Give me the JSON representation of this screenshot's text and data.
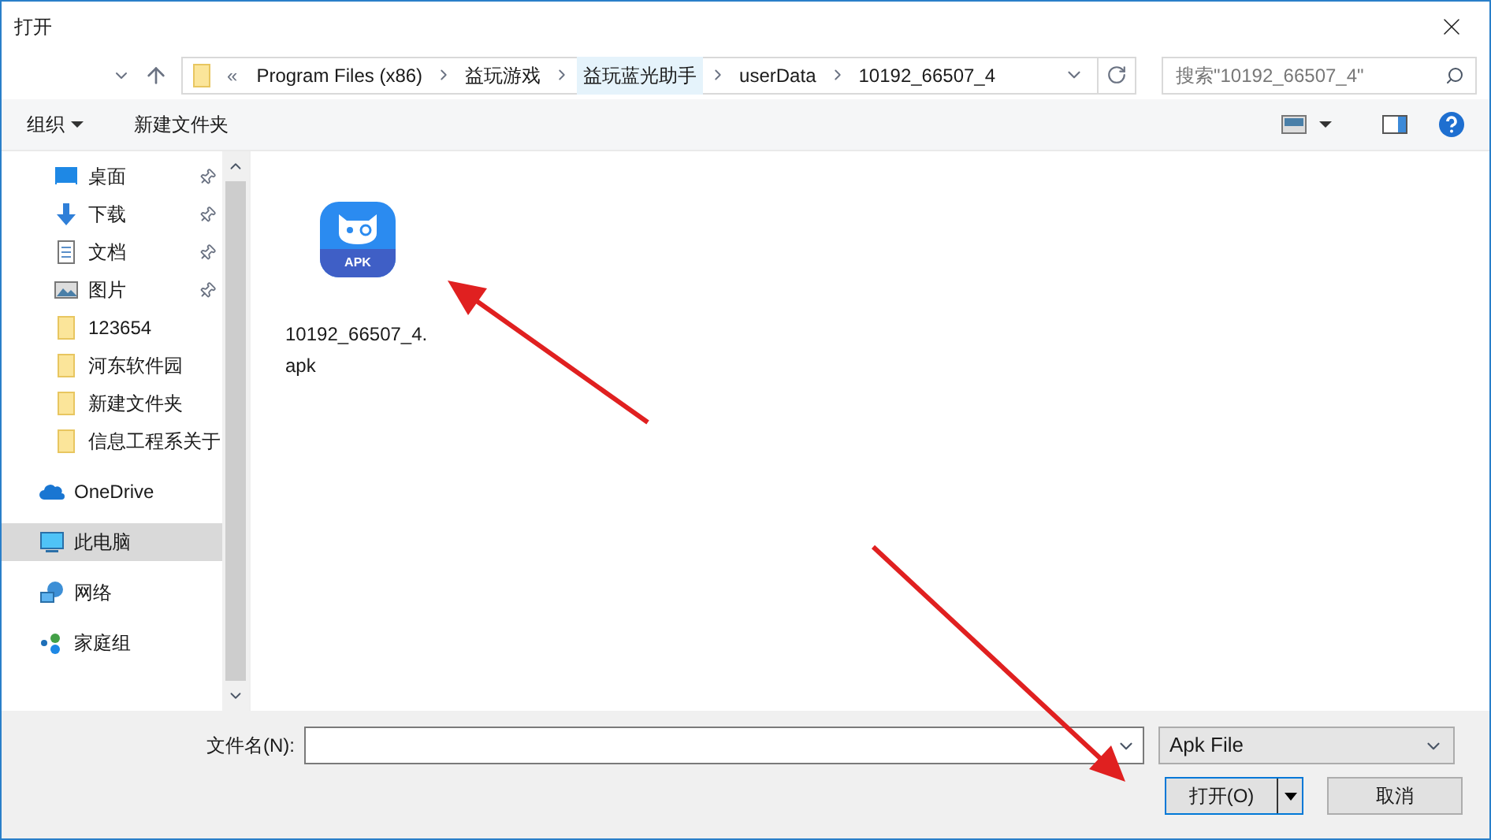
{
  "window": {
    "title": "打开"
  },
  "address": {
    "overflow": "«",
    "crumbs": [
      {
        "label": "Program Files (x86)",
        "selected": false
      },
      {
        "label": "益玩游戏",
        "selected": false
      },
      {
        "label": "益玩蓝光助手",
        "selected": true
      },
      {
        "label": "userData",
        "selected": false
      },
      {
        "label": "10192_66507_4",
        "selected": false
      }
    ]
  },
  "search": {
    "placeholder": "搜索\"10192_66507_4\""
  },
  "toolbar": {
    "organize": "组织",
    "new_folder": "新建文件夹"
  },
  "sidebar": {
    "items": [
      {
        "kind": "desktop",
        "label": "桌面",
        "pinned": true,
        "selected": false
      },
      {
        "kind": "download",
        "label": "下载",
        "pinned": true,
        "selected": false
      },
      {
        "kind": "document",
        "label": "文档",
        "pinned": true,
        "selected": false
      },
      {
        "kind": "picture",
        "label": "图片",
        "pinned": true,
        "selected": false
      },
      {
        "kind": "folder",
        "label": "123654",
        "pinned": false,
        "selected": false
      },
      {
        "kind": "folder",
        "label": "河东软件园",
        "pinned": false,
        "selected": false
      },
      {
        "kind": "folder",
        "label": "新建文件夹",
        "pinned": false,
        "selected": false
      },
      {
        "kind": "folder",
        "label": "信息工程系关于",
        "pinned": false,
        "selected": false
      },
      {
        "kind": "cloud",
        "label": "OneDrive",
        "pinned": false,
        "selected": false
      },
      {
        "kind": "computer",
        "label": "此电脑",
        "pinned": false,
        "selected": true
      },
      {
        "kind": "network",
        "label": "网络",
        "pinned": false,
        "selected": false
      },
      {
        "kind": "homegroup",
        "label": "家庭组",
        "pinned": false,
        "selected": false
      }
    ]
  },
  "files": [
    {
      "icon_label": "APK",
      "name": "10192_66507_4.apk"
    }
  ],
  "bottom": {
    "filename_label": "文件名(N):",
    "file_type": "Apk File",
    "open_button": "打开(O)",
    "cancel_button": "取消"
  }
}
